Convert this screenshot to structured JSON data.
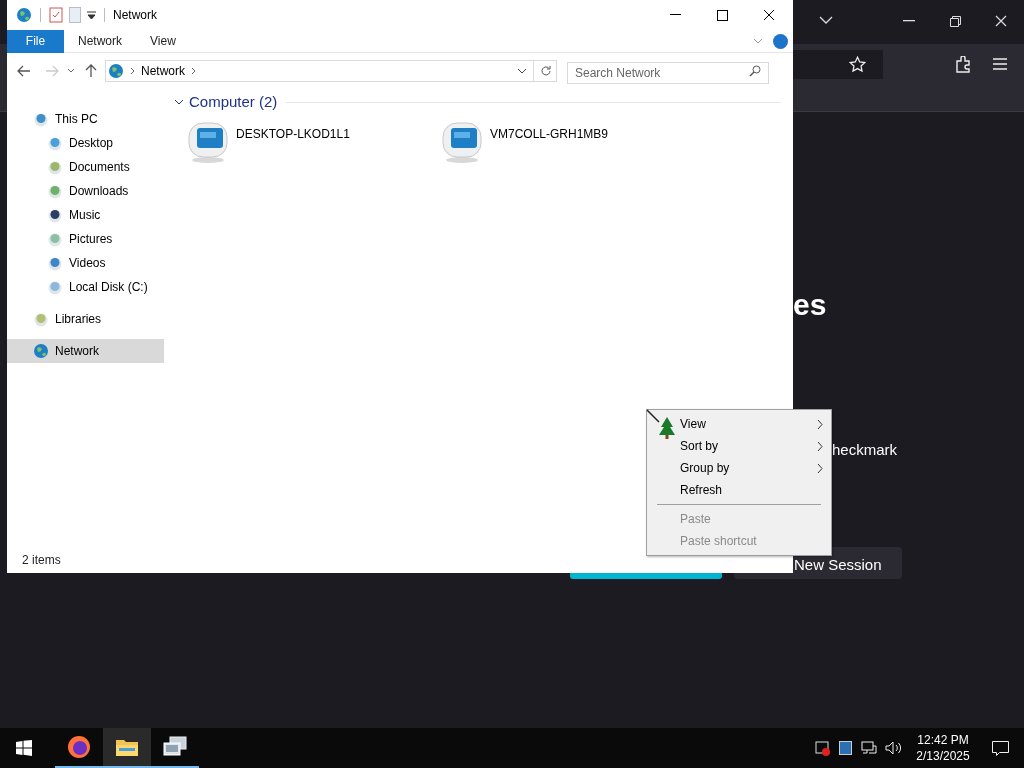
{
  "browser": {
    "heading_fragment": "es",
    "text_fragment": "heckmark",
    "button": "New Session"
  },
  "explorer": {
    "title": "Network",
    "ribbon_tabs": [
      {
        "label": "File",
        "selected": true
      },
      {
        "label": "Network",
        "selected": false
      },
      {
        "label": "View",
        "selected": false
      }
    ],
    "address": [
      "Network"
    ],
    "search": {
      "placeholder": "Search Network"
    },
    "sidebar": [
      {
        "label": "This PC",
        "kind": "pc",
        "selected": false,
        "children": [
          {
            "label": "Desktop",
            "kind": "desktop",
            "selected": false
          },
          {
            "label": "Documents",
            "kind": "documents",
            "selected": false
          },
          {
            "label": "Downloads",
            "kind": "downloads",
            "selected": false
          },
          {
            "label": "Music",
            "kind": "music",
            "selected": false
          },
          {
            "label": "Pictures",
            "kind": "pictures",
            "selected": false
          },
          {
            "label": "Videos",
            "kind": "videos",
            "selected": false
          },
          {
            "label": "Local Disk (C:)",
            "kind": "disk",
            "selected": false
          }
        ]
      },
      {
        "label": "Libraries",
        "kind": "libraries",
        "selected": false
      },
      {
        "label": "Network",
        "kind": "network",
        "selected": true
      }
    ],
    "group": {
      "title": "Computer (2)",
      "expanded": true
    },
    "items": [
      {
        "name": "DESKTOP-LKOD1L1"
      },
      {
        "name": "VM7COLL-GRH1MB9"
      }
    ],
    "status": "2 items"
  },
  "context_menu": {
    "groups": [
      [
        {
          "label": "View",
          "submenu": true,
          "disabled": false
        },
        {
          "label": "Sort by",
          "submenu": true,
          "disabled": false
        },
        {
          "label": "Group by",
          "submenu": true,
          "disabled": false
        },
        {
          "label": "Refresh",
          "submenu": false,
          "disabled": false
        }
      ],
      [
        {
          "label": "Paste",
          "submenu": false,
          "disabled": true
        },
        {
          "label": "Paste shortcut",
          "submenu": false,
          "disabled": true
        }
      ]
    ]
  },
  "taskbar": {
    "apps": [
      {
        "kind": "firefox",
        "selected": false
      },
      {
        "kind": "explorer",
        "selected": true
      },
      {
        "kind": "network-tool",
        "selected": false
      }
    ],
    "time": "12:42 PM",
    "date": "2/13/2025"
  }
}
